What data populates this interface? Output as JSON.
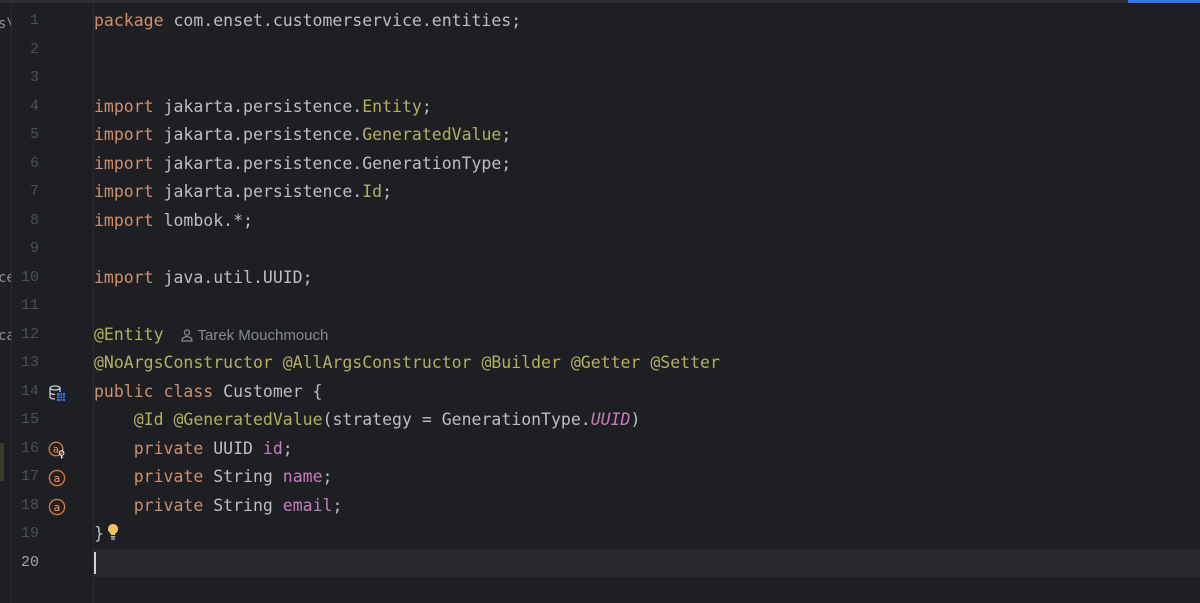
{
  "editor": {
    "lines": [
      {
        "n": "1",
        "tokens": [
          [
            "kw",
            "package"
          ],
          [
            "ident",
            " com.enset.customerservice.entities;"
          ]
        ]
      },
      {
        "n": "2",
        "tokens": []
      },
      {
        "n": "3",
        "tokens": []
      },
      {
        "n": "4",
        "tokens": [
          [
            "kw",
            "import"
          ],
          [
            "ident",
            " jakarta.persistence."
          ],
          [
            "ann",
            "Entity"
          ],
          [
            "ident",
            ";"
          ]
        ]
      },
      {
        "n": "5",
        "tokens": [
          [
            "kw",
            "import"
          ],
          [
            "ident",
            " jakarta.persistence."
          ],
          [
            "ann",
            "GeneratedValue"
          ],
          [
            "ident",
            ";"
          ]
        ]
      },
      {
        "n": "6",
        "tokens": [
          [
            "kw",
            "import"
          ],
          [
            "ident",
            " jakarta.persistence.GenerationType;"
          ]
        ]
      },
      {
        "n": "7",
        "tokens": [
          [
            "kw",
            "import"
          ],
          [
            "ident",
            " jakarta.persistence."
          ],
          [
            "ann",
            "Id"
          ],
          [
            "ident",
            ";"
          ]
        ]
      },
      {
        "n": "8",
        "tokens": [
          [
            "kw",
            "import"
          ],
          [
            "ident",
            " lombok.*;"
          ]
        ]
      },
      {
        "n": "9",
        "tokens": []
      },
      {
        "n": "10",
        "tokens": [
          [
            "kw",
            "import"
          ],
          [
            "ident",
            " java.util.UUID;"
          ]
        ]
      },
      {
        "n": "11",
        "tokens": []
      },
      {
        "n": "12",
        "tokens": [
          [
            "ann",
            "@Entity"
          ]
        ],
        "inlay": "Tarek Mouchmouch"
      },
      {
        "n": "13",
        "tokens": [
          [
            "ann",
            "@NoArgsConstructor"
          ],
          [
            "ident",
            " "
          ],
          [
            "ann",
            "@AllArgsConstructor"
          ],
          [
            "ident",
            " "
          ],
          [
            "ann",
            "@Builder"
          ],
          [
            "ident",
            " "
          ],
          [
            "ann",
            "@Getter"
          ],
          [
            "ident",
            " "
          ],
          [
            "ann",
            "@Setter"
          ]
        ]
      },
      {
        "n": "14",
        "tokens": [
          [
            "kw",
            "public class"
          ],
          [
            "ident",
            " Customer {"
          ]
        ],
        "gutter_icon": "database-table-icon"
      },
      {
        "n": "15",
        "tokens": [
          [
            "ident",
            "    "
          ],
          [
            "ann",
            "@Id"
          ],
          [
            "ident",
            " "
          ],
          [
            "ann",
            "@GeneratedValue"
          ],
          [
            "ident",
            "(strategy = GenerationType."
          ],
          [
            "static",
            "UUID"
          ],
          [
            "ident",
            ")"
          ]
        ]
      },
      {
        "n": "16",
        "tokens": [
          [
            "ident",
            "    "
          ],
          [
            "kw",
            "private"
          ],
          [
            "ident",
            " UUID "
          ],
          [
            "field",
            "id"
          ],
          [
            "ident",
            ";"
          ]
        ],
        "gutter_icon": "field-key-icon"
      },
      {
        "n": "17",
        "tokens": [
          [
            "ident",
            "    "
          ],
          [
            "kw",
            "private"
          ],
          [
            "ident",
            " String "
          ],
          [
            "field",
            "name"
          ],
          [
            "ident",
            ";"
          ]
        ],
        "gutter_icon": "field-icon"
      },
      {
        "n": "18",
        "tokens": [
          [
            "ident",
            "    "
          ],
          [
            "kw",
            "private"
          ],
          [
            "ident",
            " String "
          ],
          [
            "field",
            "email"
          ],
          [
            "ident",
            ";"
          ]
        ],
        "gutter_icon": "field-icon"
      },
      {
        "n": "19",
        "tokens": [
          [
            "ident",
            "}"
          ]
        ],
        "bulb": true
      },
      {
        "n": "20",
        "tokens": [],
        "current": true
      }
    ]
  },
  "left_strip": {
    "fragments": [
      "s\\",
      "ce",
      "ca"
    ]
  },
  "colors": {
    "background": "#1e1f22",
    "keyword": "#cf8e6d",
    "identifier": "#bcbec4",
    "annotation": "#b3ae60",
    "field": "#c77dbb",
    "line_number": "#4b5059",
    "accent": "#3574f0"
  },
  "icons": {
    "inlay_author": "user-icon",
    "intention": "lightbulb-icon"
  }
}
